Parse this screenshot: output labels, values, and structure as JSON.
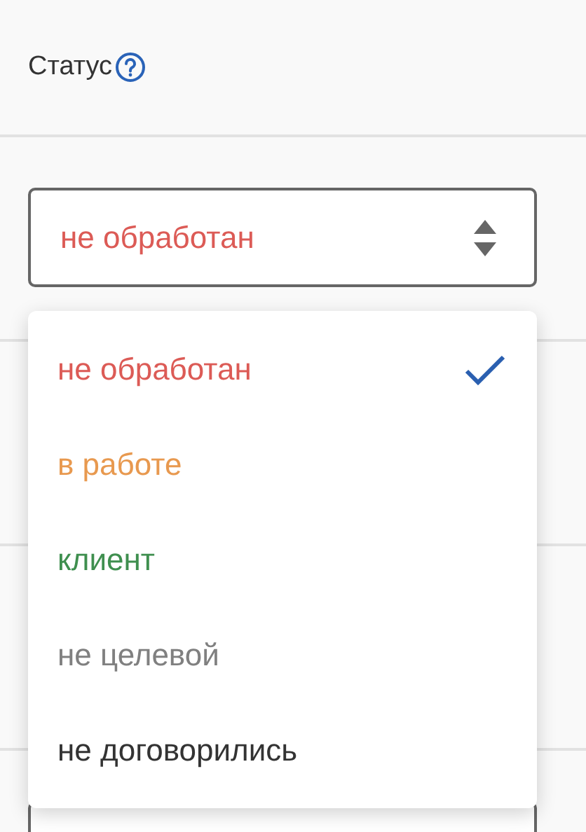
{
  "field": {
    "label": "Статус",
    "select": {
      "value": "не обработан",
      "color": "#dc5b56"
    }
  },
  "menu": {
    "options": [
      {
        "label": "не обработан",
        "color": "#dc5b56",
        "selected": true
      },
      {
        "label": "в работе",
        "color": "#e8994f",
        "selected": false
      },
      {
        "label": "клиент",
        "color": "#3f8f4f",
        "selected": false
      },
      {
        "label": "не целевой",
        "color": "#808080",
        "selected": false
      },
      {
        "label": "не договорились",
        "color": "#333333",
        "selected": false
      }
    ]
  }
}
